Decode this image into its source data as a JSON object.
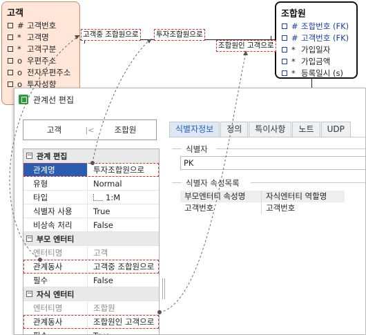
{
  "erd": {
    "customer": {
      "title": "고객",
      "attributes": [
        {
          "mark": "#",
          "name": "고객번호"
        },
        {
          "mark": "*",
          "name": "고객명"
        },
        {
          "mark": "*",
          "name": "고객구분"
        },
        {
          "mark": "o",
          "name": "우편주소"
        },
        {
          "mark": "o",
          "name": "전자우편주소"
        },
        {
          "mark": "o",
          "name": "투자성향"
        }
      ]
    },
    "union": {
      "title": "조합원",
      "attributes": [
        {
          "mark": "#",
          "name": "조합번호",
          "tag": "(FK)"
        },
        {
          "mark": "#",
          "name": "고객번호",
          "tag": "(FK)"
        },
        {
          "mark": "*",
          "name": "가입일자",
          "tag": ""
        },
        {
          "mark": "*",
          "name": "가입금액",
          "tag": ""
        },
        {
          "mark": "*",
          "name": "등록일시",
          "tag": "(s)"
        }
      ]
    },
    "relationship_labels": {
      "parent_verb": "고객중 조합원으로",
      "relationship_name": "투자조합원으로",
      "child_verb": "조합원인 고객으로"
    }
  },
  "dialog": {
    "title": "관계선 편집",
    "diagram": {
      "parent": "고객",
      "connector": "|<",
      "child": "조합원"
    },
    "properties": {
      "section_relation": "관계 편집",
      "relation_name_key": "관계명",
      "relation_name_value": "투자조합원으로",
      "type_key": "유형",
      "type_value": "Normal",
      "kind_key": "타입",
      "kind_value": "1:M",
      "use_identifier_key": "식별자 사용",
      "use_identifier_value": "True",
      "non_attr_key": "비상속 처리",
      "non_attr_value": "False",
      "section_parent": "부모 엔터티",
      "parent_entity_key": "엔터티명",
      "parent_entity_value": "고객",
      "parent_verb_key": "관계동사",
      "parent_verb_value": "고객중 조합원으로",
      "parent_required_key": "필수",
      "parent_required_value": "False",
      "section_child": "자식 엔터티",
      "child_entity_key": "엔터티명",
      "child_entity_value": "조합원",
      "child_verb_key": "관계동사",
      "child_verb_value": "조합원인 고객으로",
      "child_required_key": "필수",
      "child_required_value": "True"
    },
    "tabs": [
      "식별자정보",
      "정의",
      "특이사항",
      "노트",
      "UDP"
    ],
    "active_tab": "식별자정보",
    "identifier_group_label": "식별자",
    "identifier_value": "PK",
    "identifier_attrs_group_label": "식별자 속성목록",
    "attr_table": {
      "headers": [
        "부모엔터티 속성명",
        "자식엔터티 역할명"
      ],
      "rows": [
        [
          "고객번호",
          "고객번호"
        ]
      ]
    }
  },
  "colors": {
    "customer_fill": "#ffe6d8",
    "highlight_dash": "#d0342c",
    "selection_blue": "#2a5db0",
    "fk_text": "#1b3fa0"
  }
}
